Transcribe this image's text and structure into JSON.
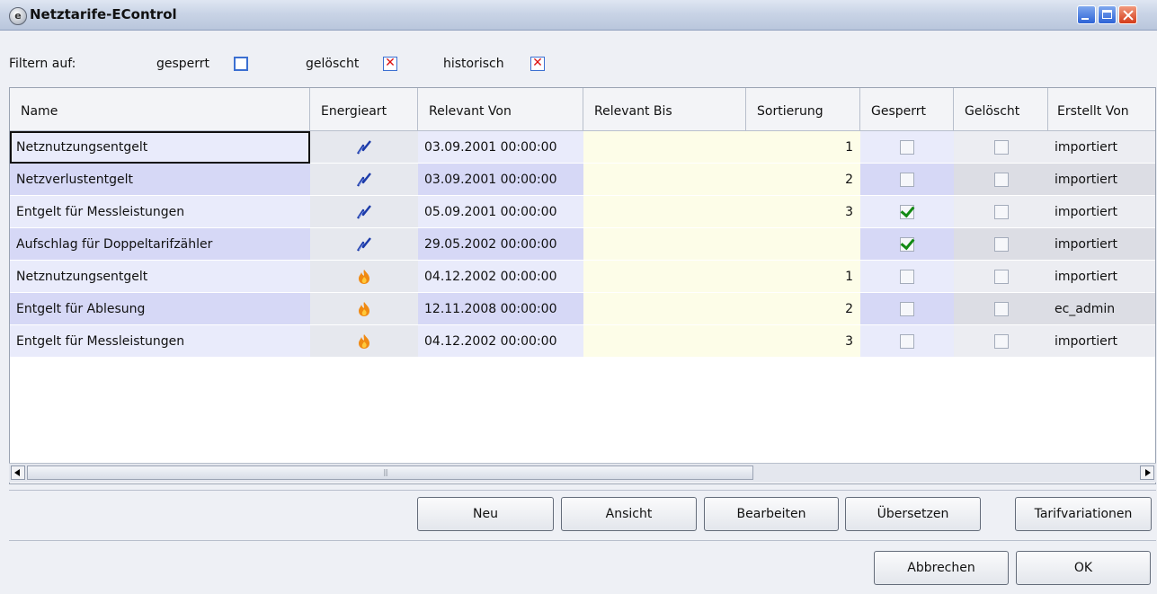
{
  "window": {
    "title": "Netztarife-EControl",
    "icon": "econtrol-logo-icon"
  },
  "filter": {
    "label": "Filtern auf:",
    "items": [
      {
        "label": "gesperrt",
        "checked": false
      },
      {
        "label": "gelöscht",
        "checked": true
      },
      {
        "label": "historisch",
        "checked": true
      }
    ]
  },
  "table": {
    "columns": [
      "Name",
      "Energieart",
      "Relevant Von",
      "Relevant Bis",
      "Sortierung",
      "Gesperrt",
      "Gelöscht",
      "Erstellt Von"
    ],
    "rows": [
      {
        "name": "Netznutzungsentgelt",
        "energieart": "strom",
        "relevant_von": "03.09.2001 00:00:00",
        "relevant_bis": "",
        "sortierung": "1",
        "gesperrt": false,
        "geloescht": false,
        "erstellt_von": "importiert"
      },
      {
        "name": "Netzverlustentgelt",
        "energieart": "strom",
        "relevant_von": "03.09.2001 00:00:00",
        "relevant_bis": "",
        "sortierung": "2",
        "gesperrt": false,
        "geloescht": false,
        "erstellt_von": "importiert"
      },
      {
        "name": "Entgelt für Messleistungen",
        "energieart": "strom",
        "relevant_von": "05.09.2001 00:00:00",
        "relevant_bis": "",
        "sortierung": "3",
        "gesperrt": true,
        "geloescht": false,
        "erstellt_von": "importiert"
      },
      {
        "name": "Aufschlag für Doppeltarifzähler",
        "energieart": "strom",
        "relevant_von": "29.05.2002 00:00:00",
        "relevant_bis": "",
        "sortierung": "",
        "gesperrt": true,
        "geloescht": false,
        "erstellt_von": "importiert"
      },
      {
        "name": "Netznutzungsentgelt",
        "energieart": "gas",
        "relevant_von": "04.12.2002 00:00:00",
        "relevant_bis": "",
        "sortierung": "1",
        "gesperrt": false,
        "geloescht": false,
        "erstellt_von": "importiert"
      },
      {
        "name": "Entgelt für Ablesung",
        "energieart": "gas",
        "relevant_von": "12.11.2008 00:00:00",
        "relevant_bis": "",
        "sortierung": "2",
        "gesperrt": false,
        "geloescht": false,
        "erstellt_von": "ec_admin"
      },
      {
        "name": "Entgelt für Messleistungen",
        "energieart": "gas",
        "relevant_von": "04.12.2002 00:00:00",
        "relevant_bis": "",
        "sortierung": "3",
        "gesperrt": false,
        "geloescht": false,
        "erstellt_von": "importiert"
      }
    ]
  },
  "icons": {
    "strom": "lightning-icon",
    "gas": "flame-icon"
  },
  "actions": [
    "Neu",
    "Ansicht",
    "Bearbeiten",
    "Übersetzen",
    "Tarifvariationen"
  ],
  "dialog": {
    "cancel": "Abbrechen",
    "ok": "OK"
  },
  "colors": {
    "row_a": "#e9ebfb",
    "row_b": "#d6d8f6",
    "relevant_bis": "#fdfde8",
    "accent": "#3b6fd1",
    "check": "#138a14",
    "cross": "#dd1111"
  }
}
